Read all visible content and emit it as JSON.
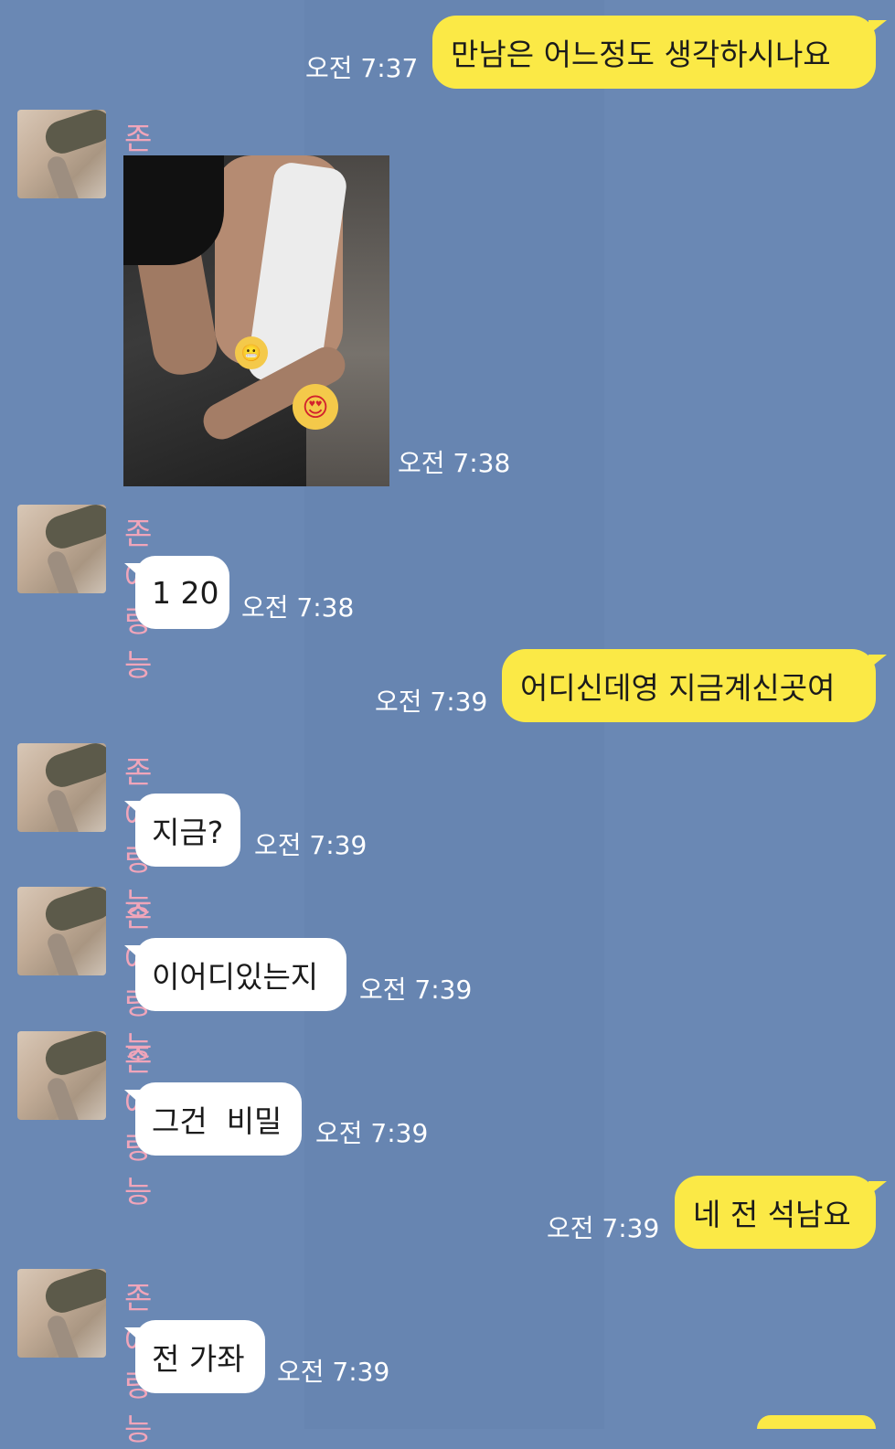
{
  "contact_name": "존예랑능",
  "messages": [
    {
      "from": "me",
      "text": "만남은 어느정도 생각하시나요",
      "time": "오전 7:37"
    },
    {
      "from": "them",
      "type": "image",
      "time": "오전 7:38",
      "image": {
        "emojis": [
          "grimacing-face-emoji",
          "heart-eyes-emoji"
        ]
      }
    },
    {
      "from": "them",
      "text": "1 20",
      "time": "오전 7:38"
    },
    {
      "from": "me",
      "text": "어디신데영 지금계신곳여",
      "time": "오전 7:39"
    },
    {
      "from": "them",
      "text": "지금?",
      "time": "오전 7:39"
    },
    {
      "from": "them",
      "text": "이어디있는지",
      "time": "오전 7:39"
    },
    {
      "from": "them",
      "text": "그건  비밀",
      "time": "오전 7:39"
    },
    {
      "from": "me",
      "text": "네 전 석남요",
      "time": "오전 7:39"
    },
    {
      "from": "them",
      "text": "전 가좌",
      "time": "오전 7:39"
    }
  ],
  "colors": {
    "background": "#6a88b4",
    "my_bubble": "#fbe946",
    "their_bubble": "#ffffff",
    "name": "#f0a5ba"
  }
}
